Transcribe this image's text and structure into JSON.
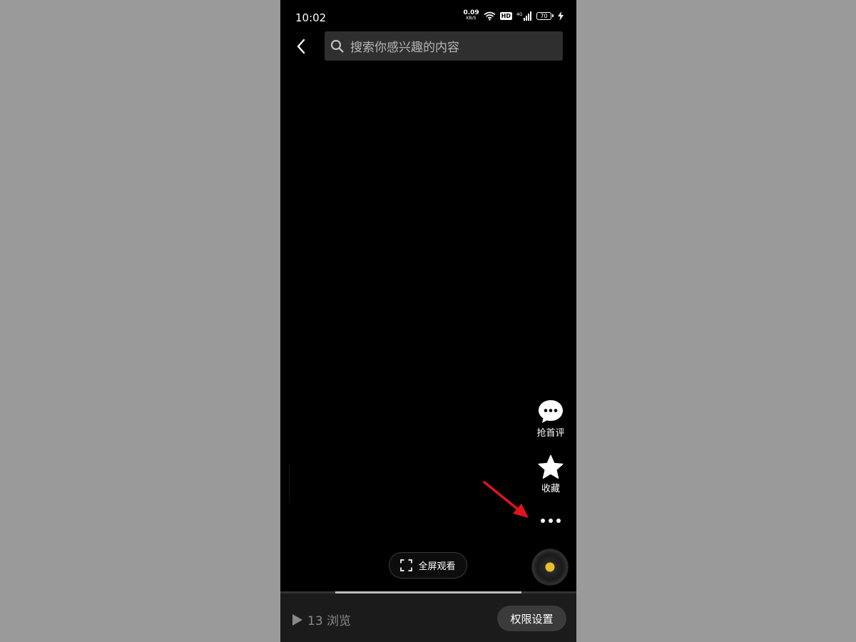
{
  "colors": {
    "page_background": "#9a9a9a",
    "screen_background": "#000000",
    "accent_disc": "#e8c12a",
    "annotation_arrow": "#e0141e"
  },
  "status_bar": {
    "time": "10:02",
    "net_speed_value": "0.09",
    "net_speed_unit": "KB/S",
    "hd_badge": "HD",
    "network_type": "4G",
    "battery_level": "70",
    "icons": [
      "wifi-icon",
      "signal-icon",
      "charging-icon"
    ]
  },
  "top_bar": {
    "back_icon": "chevron-left-icon",
    "search_placeholder": "搜索你感兴趣的内容",
    "search_icon": "search-icon"
  },
  "side_actions": {
    "comment_label": "抢首评",
    "collect_label": "收藏",
    "more_icon": "more-dots-icon"
  },
  "fullscreen": {
    "label": "全屏观看",
    "icon": "fullscreen-icon"
  },
  "progress": {
    "fraction": 0.63
  },
  "bottom_bar": {
    "views_text": "13 浏览",
    "permission_label": "权限设置"
  }
}
